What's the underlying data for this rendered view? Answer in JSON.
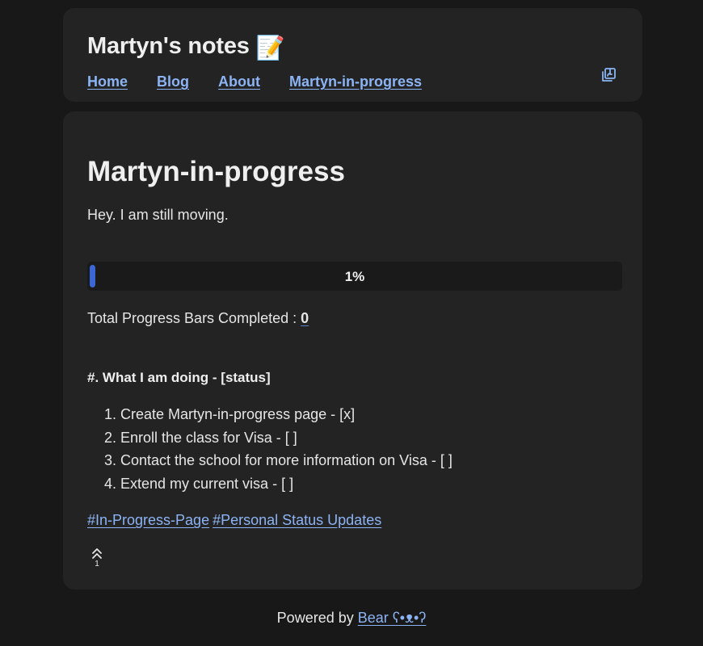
{
  "header": {
    "site_title": "Martyn's notes",
    "title_emoji": "📝",
    "nav": [
      {
        "label": "Home"
      },
      {
        "label": "Blog"
      },
      {
        "label": "About"
      },
      {
        "label": "Martyn-in-progress"
      }
    ],
    "rss_icon": "copy-rss-icon"
  },
  "main": {
    "page_title": "Martyn-in-progress",
    "intro": "Hey. I am still moving.",
    "progress": {
      "label": "1%",
      "value_percent": 1,
      "fill_color": "#3a66d6"
    },
    "total_label": "Total Progress Bars Completed :",
    "total_count": "0",
    "section_heading": "#. What I am doing - [status]",
    "todo_items": [
      "Create Martyn-in-progress page - [x]",
      "Enroll the class for Visa - [ ]",
      "Contact the school for more information on Visa - [ ]",
      "Extend my current visa - [ ]"
    ],
    "tags": [
      "#In-Progress-Page",
      "#Personal Status Updates"
    ],
    "upvote_count": "1",
    "upvote_icon": "double-chevron-up-icon"
  },
  "footer": {
    "prefix": "Powered by",
    "link": "Bear ʕ•ᴥ•ʔ"
  },
  "colors": {
    "background": "#181818",
    "card": "#232323",
    "link": "#8cb4f5",
    "accent": "#3a66d6"
  }
}
